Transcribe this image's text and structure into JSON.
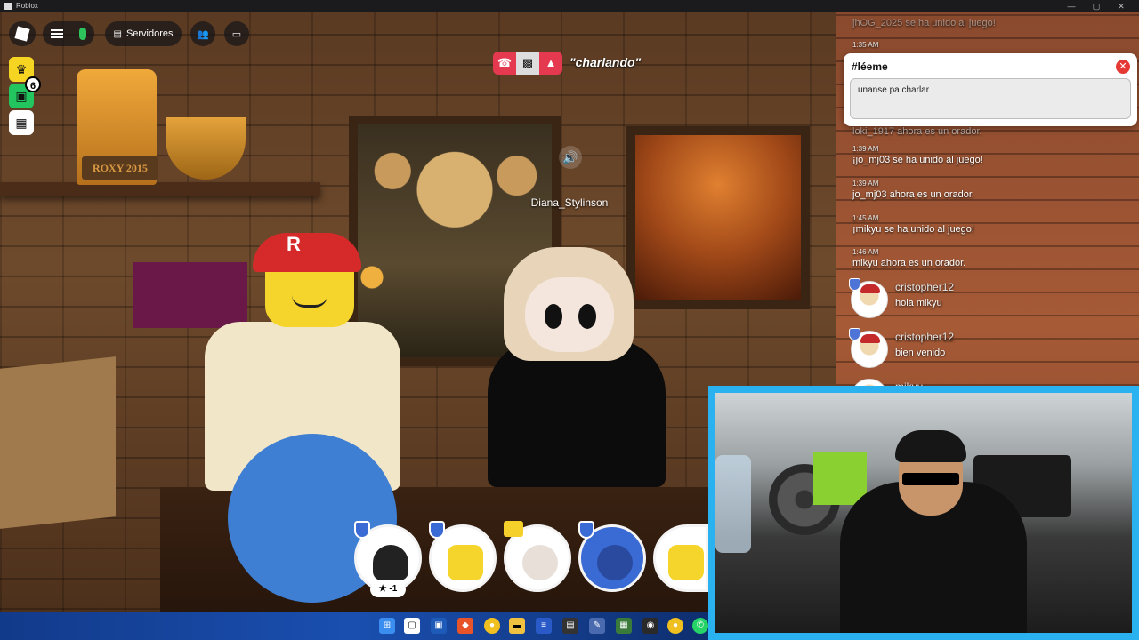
{
  "window": {
    "title": "Roblox"
  },
  "topbar": {
    "servers_label": "Servidores"
  },
  "side": {
    "badge_count": "6"
  },
  "voice_controls": {
    "status_text": "\"charlando\""
  },
  "scene": {
    "username_tag": "Diana_Stylinson",
    "trophy_text": "ROXY 2015"
  },
  "pinned": {
    "title": "#léeme",
    "message": "unanse pa charlar"
  },
  "chat": {
    "lines": [
      {
        "time": "",
        "text": "jhOG_2025 se ha unido al juego!"
      },
      {
        "time": "1:35 AM",
        "text": ""
      },
      {
        "time": "",
        "text": "loki_1917 ahora es un orador."
      },
      {
        "time": "1:39 AM",
        "text": "¡jo_mj03 se ha unido al juego!"
      },
      {
        "time": "1:39 AM",
        "text": "jo_mj03 ahora es un orador."
      },
      {
        "time": "1:45 AM",
        "text": "¡mikyu se ha unido al juego!"
      },
      {
        "time": "1:46 AM",
        "text": "mikyu ahora es un orador."
      }
    ],
    "messages": [
      {
        "user": "cristopher12",
        "text": "hola mikyu"
      },
      {
        "user": "cristopher12",
        "text": "bien venido"
      },
      {
        "user": "mikyu",
        "text": ""
      }
    ]
  },
  "voice_strip": {
    "star_label": "★ -1"
  },
  "colors": {
    "accent_blue": "#2ab2f0",
    "voice_red": "#e53950",
    "mic_green": "#2ec45c"
  }
}
